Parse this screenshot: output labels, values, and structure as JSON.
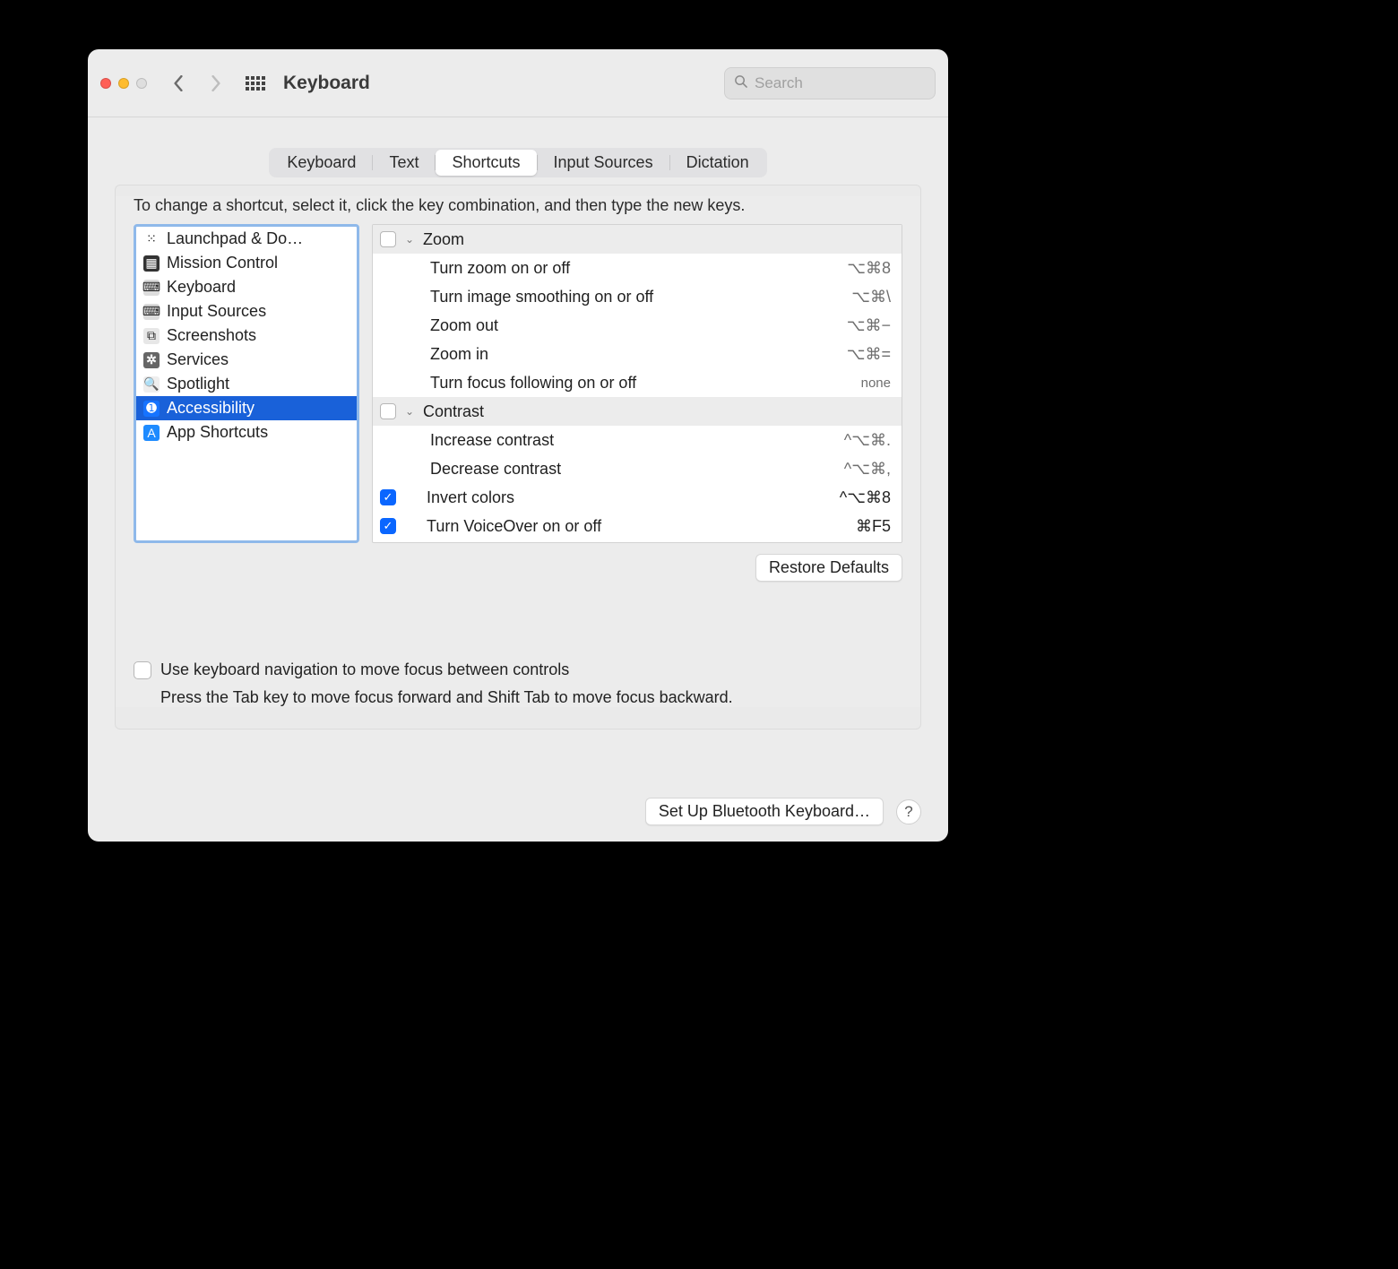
{
  "window": {
    "title": "Keyboard"
  },
  "search": {
    "placeholder": "Search"
  },
  "tabs": [
    {
      "label": "Keyboard"
    },
    {
      "label": "Text"
    },
    {
      "label": "Shortcuts",
      "active": true
    },
    {
      "label": "Input Sources"
    },
    {
      "label": "Dictation"
    }
  ],
  "instruction": "To change a shortcut, select it, click the key combination, and then type the new keys.",
  "categories": [
    {
      "label": "Launchpad & Do…",
      "icon": "launchpad"
    },
    {
      "label": "Mission Control",
      "icon": "mission"
    },
    {
      "label": "Keyboard",
      "icon": "keyboard"
    },
    {
      "label": "Input Sources",
      "icon": "input"
    },
    {
      "label": "Screenshots",
      "icon": "screens"
    },
    {
      "label": "Services",
      "icon": "services"
    },
    {
      "label": "Spotlight",
      "icon": "spotlight"
    },
    {
      "label": "Accessibility",
      "icon": "access",
      "selected": true
    },
    {
      "label": "App Shortcuts",
      "icon": "appshort"
    }
  ],
  "shortcuts": {
    "groups": [
      {
        "name": "Zoom",
        "checked": false,
        "items": [
          {
            "label": "Turn zoom on or off",
            "keys": "⌥⌘8"
          },
          {
            "label": "Turn image smoothing on or off",
            "keys": "⌥⌘\\"
          },
          {
            "label": "Zoom out",
            "keys": "⌥⌘−"
          },
          {
            "label": "Zoom in",
            "keys": "⌥⌘="
          },
          {
            "label": "Turn focus following on or off",
            "keys": "none",
            "none": true
          }
        ]
      },
      {
        "name": "Contrast",
        "checked": false,
        "items": [
          {
            "label": "Increase contrast",
            "keys": "^⌥⌘."
          },
          {
            "label": "Decrease contrast",
            "keys": "^⌥⌘,"
          }
        ]
      }
    ],
    "solo": [
      {
        "label": "Invert colors",
        "keys": "^⌥⌘8",
        "checked": true
      },
      {
        "label": "Turn VoiceOver on or off",
        "keys": "⌘F5",
        "checked": true
      }
    ]
  },
  "restore_label": "Restore Defaults",
  "nav_option": {
    "label": "Use keyboard navigation to move focus between controls",
    "sub": "Press the Tab key to move focus forward and Shift Tab to move focus backward."
  },
  "footer": {
    "bluetooth": "Set Up Bluetooth Keyboard…",
    "help": "?"
  }
}
